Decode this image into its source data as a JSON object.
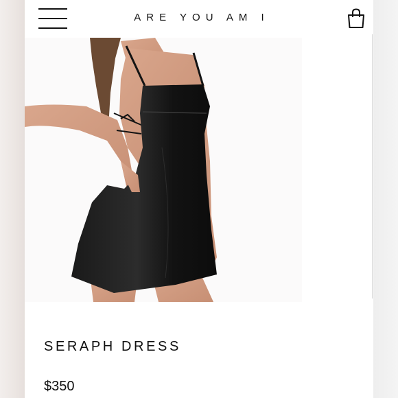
{
  "header": {
    "brand": "ARE YOU AM I",
    "menu_icon": "hamburger-menu-icon",
    "bag_icon": "shopping-bag-icon"
  },
  "product": {
    "name": "SERAPH DRESS",
    "price": "$350",
    "image_alt": "model wearing black satin slip mini dress, back view showing lace-up open back"
  },
  "colors": {
    "background": "#ffffff",
    "text": "#111111",
    "dress": "#151515"
  }
}
